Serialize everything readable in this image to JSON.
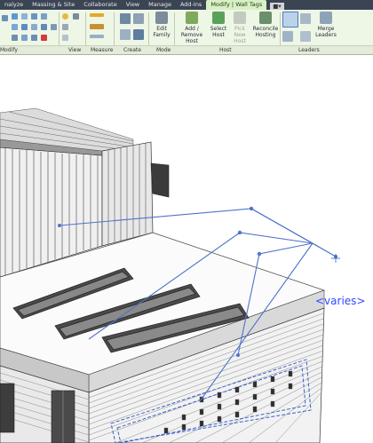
{
  "tabs": [
    {
      "label": "nalyze",
      "active": false
    },
    {
      "label": "Massing & Site",
      "active": false
    },
    {
      "label": "Collaborate",
      "active": false
    },
    {
      "label": "View",
      "active": false
    },
    {
      "label": "Manage",
      "active": false
    },
    {
      "label": "Add-Ins",
      "active": false
    },
    {
      "label": "Modify | Wall Tags",
      "active": true
    }
  ],
  "ribbon": {
    "panels": {
      "modify": "Modify",
      "view": "View",
      "measure": "Measure",
      "create": "Create",
      "mode": "Mode",
      "host": "Host",
      "leaders": "Leaders"
    },
    "buttons": {
      "edit_family": [
        "Edit",
        "Family"
      ],
      "add_remove_host": [
        "Add / Remove",
        "Host"
      ],
      "select_host": [
        "Select",
        "Host"
      ],
      "pick_new_host": [
        "Pick New",
        "Host"
      ],
      "reconcile_hosting": [
        "Reconcile",
        "Hosting"
      ],
      "merge_leaders": [
        "Merge",
        "Leaders"
      ]
    }
  },
  "canvas": {
    "tag_text": "<varies>",
    "colors": {
      "tag": "#2f49ff",
      "leader": "#4f74c9",
      "selection": "#3b63c8",
      "ribbon_bg": "#eef6e6",
      "active_tab": "#d9f0c4"
    }
  }
}
